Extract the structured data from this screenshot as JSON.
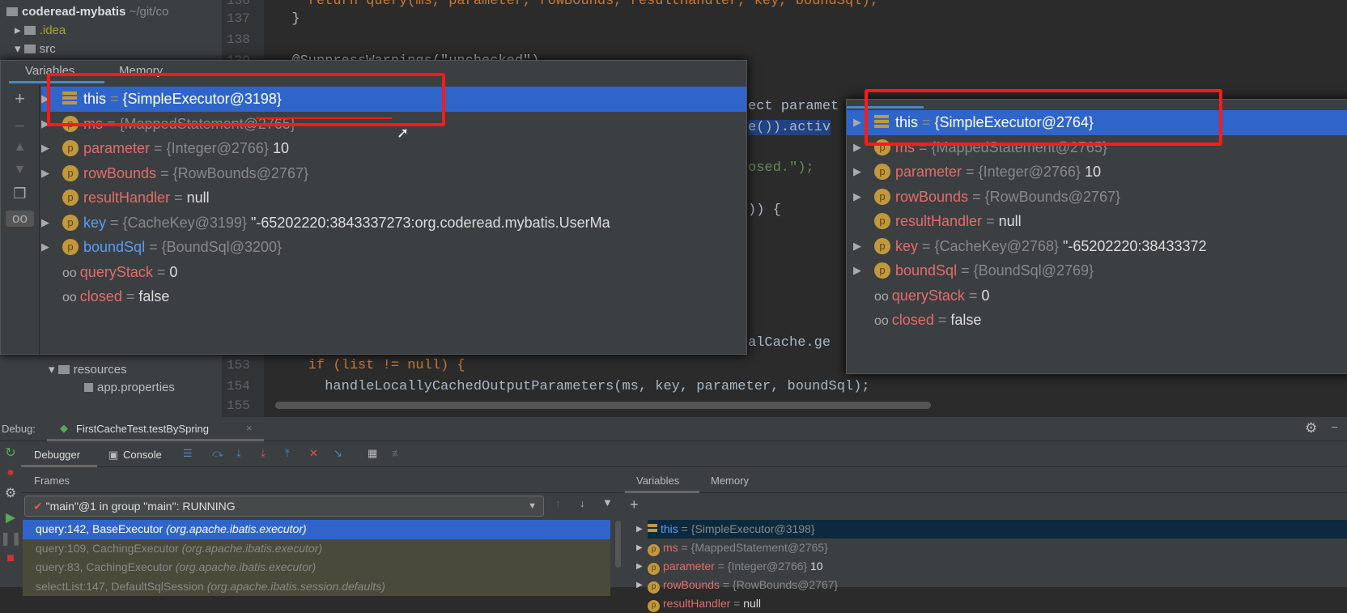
{
  "project": {
    "root": "coderead-mybatis",
    "root_path": "~/git/co",
    "items": [
      "idea",
      "src"
    ],
    "idea_label": ".idea",
    "resources": "resources",
    "app_props": "app.properties"
  },
  "editor": {
    "lines": [
      {
        "n": "136",
        "code": "    return query(ms, parameter, rowBounds, resultHandler, key, boundSql);"
      },
      {
        "n": "137",
        "code": "  }"
      },
      {
        "n": "138",
        "code": ""
      },
      {
        "n": "139",
        "code": "  @SuppressWarnings(\"unchecked\")"
      },
      {
        "n": "153",
        "code": "    if (list != null) {"
      },
      {
        "n": "154",
        "code": "      handleLocallyCachedOutputParameters(ms, key, parameter, boundSql);"
      },
      {
        "n": "155",
        "code": ""
      }
    ],
    "fragments": {
      "param": "ect paramet",
      "activ": "e()).activ",
      "sed": "osed.\");",
      "brace": ")) {",
      "cache": "alCache.ge"
    }
  },
  "popup_left": {
    "tabs": [
      "Variables",
      "Memory"
    ],
    "vars": [
      {
        "name": "this",
        "type": "{SimpleExecutor@3198}",
        "value": ""
      },
      {
        "name": "ms",
        "type": "{MappedStatement@2765}",
        "value": ""
      },
      {
        "name": "parameter",
        "type": "{Integer@2766}",
        "value": "10"
      },
      {
        "name": "rowBounds",
        "type": "{RowBounds@2767}",
        "value": ""
      },
      {
        "name": "resultHandler",
        "type": "",
        "value": "null"
      },
      {
        "name": "key",
        "type": "{CacheKey@3199}",
        "value": "\"-65202220:3843337273:org.coderead.mybatis.UserMa"
      },
      {
        "name": "boundSql",
        "type": "{BoundSql@3200}",
        "value": ""
      },
      {
        "name": "queryStack",
        "type": "",
        "value": "0"
      },
      {
        "name": "closed",
        "type": "",
        "value": "false"
      }
    ]
  },
  "popup_right": {
    "vars": [
      {
        "name": "this",
        "type": "{SimpleExecutor@2764}",
        "value": ""
      },
      {
        "name": "ms",
        "type": "{MappedStatement@2765}",
        "value": ""
      },
      {
        "name": "parameter",
        "type": "{Integer@2766}",
        "value": "10"
      },
      {
        "name": "rowBounds",
        "type": "{RowBounds@2767}",
        "value": ""
      },
      {
        "name": "resultHandler",
        "type": "",
        "value": "null"
      },
      {
        "name": "key",
        "type": "{CacheKey@2768}",
        "value": "\"-65202220:38433372"
      },
      {
        "name": "boundSql",
        "type": "{BoundSql@2769}",
        "value": ""
      },
      {
        "name": "queryStack",
        "type": "",
        "value": "0"
      },
      {
        "name": "closed",
        "type": "",
        "value": "false"
      }
    ]
  },
  "debug": {
    "label": "Debug:",
    "session": "FirstCacheTest.testBySpring",
    "tabs": [
      "Debugger",
      "Console"
    ],
    "frames_title": "Frames",
    "thread": "\"main\"@1 in group \"main\": RUNNING",
    "frames": [
      {
        "loc": "query:142, BaseExecutor",
        "pkg": "(org.apache.ibatis.executor)"
      },
      {
        "loc": "query:109, CachingExecutor",
        "pkg": "(org.apache.ibatis.executor)"
      },
      {
        "loc": "query:83, CachingExecutor",
        "pkg": "(org.apache.ibatis.executor)"
      },
      {
        "loc": "selectList:147, DefaultSqlSession",
        "pkg": "(org.apache.ibatis.session.defaults)"
      }
    ],
    "var_tabs": [
      "Variables",
      "Memory"
    ],
    "vars": [
      {
        "name": "this",
        "type": "{SimpleExecutor@3198}",
        "value": ""
      },
      {
        "name": "ms",
        "type": "{MappedStatement@2765}",
        "value": ""
      },
      {
        "name": "parameter",
        "type": "{Integer@2766}",
        "value": "10"
      },
      {
        "name": "rowBounds",
        "type": "{RowBounds@2767}",
        "value": ""
      },
      {
        "name": "resultHandler",
        "type": "",
        "value": "null"
      }
    ]
  },
  "colors": {
    "highlight": "#2f65ca",
    "annotation": "#ff1a1a"
  }
}
